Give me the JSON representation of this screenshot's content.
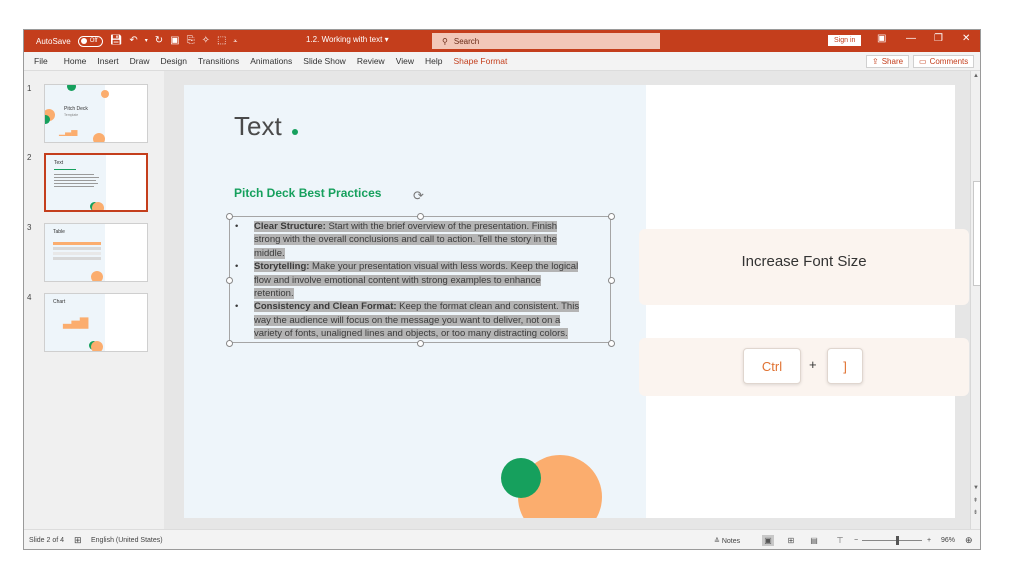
{
  "titlebar": {
    "autosave_label": "AutoSave",
    "autosave_state": "Off",
    "doc_title": "1.2. Working with text",
    "doc_title_caret": "▾",
    "search_placeholder": "Search",
    "signin_label": "Sign in",
    "brand_color": "#c43e1c"
  },
  "menu": {
    "items": [
      "File",
      "Home",
      "Insert",
      "Draw",
      "Design",
      "Transitions",
      "Animations",
      "Slide Show",
      "Review",
      "View",
      "Help",
      "Shape Format"
    ],
    "share_label": "Share",
    "comments_label": "Comments"
  },
  "thumbnails": [
    {
      "number": "1",
      "title": "Pitch Deck",
      "subtitle": "Template"
    },
    {
      "number": "2",
      "title": "Text"
    },
    {
      "number": "3",
      "title": "Table"
    },
    {
      "number": "4",
      "title": "Chart"
    }
  ],
  "slide": {
    "title": "Text",
    "subtitle": "Pitch Deck Best Practices",
    "bullets": [
      {
        "heading": "Clear Structure:",
        "lines": [
          " Start with the brief overview of the presentation. Finish",
          "strong with the overall conclusions and call to action. Tell the story in the",
          "middle."
        ]
      },
      {
        "heading": "Storytelling:",
        "lines": [
          " Make your presentation visual with less words. Keep the logical",
          "flow and involve emotional content with strong examples to enhance",
          "retention."
        ]
      },
      {
        "heading": "Consistency and Clean Format:",
        "lines": [
          " Keep the format clean and consistent. This",
          "way the audience will focus on the message you want to deliver, not on a",
          "variety of fonts, unaligned lines and objects, or too many distracting colors."
        ]
      }
    ],
    "accent_green": "#16a05d",
    "accent_orange": "#fbad6e"
  },
  "shortcut_hint": {
    "title": "Increase Font Size",
    "key1": "Ctrl",
    "plus": "+",
    "key2": "]"
  },
  "statusbar": {
    "slide_info": "Slide 2 of 4",
    "language": "English (United States)",
    "notes_label": "Notes",
    "zoom_minus": "−",
    "zoom_plus": "+",
    "zoom_value": "96%"
  }
}
